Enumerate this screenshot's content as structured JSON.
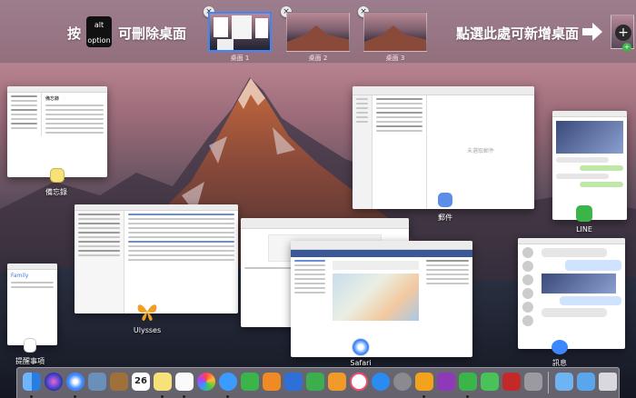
{
  "spaces_bar": {
    "hint_press": "按",
    "key_line1": "alt",
    "key_line2": "option",
    "hint_remove": "可刪除桌面",
    "hint_add": "點選此處可新增桌面",
    "close_glyph": "×",
    "add_glyph": "+",
    "desktops": [
      {
        "label": "桌面 1",
        "active": true
      },
      {
        "label": "桌面 2",
        "active": false
      },
      {
        "label": "桌面 3",
        "active": false
      }
    ]
  },
  "windows": {
    "notes": {
      "label": "備忘錄",
      "heading": "備忘錄"
    },
    "mail": {
      "label": "郵件",
      "placeholder": "未選取郵件"
    },
    "line": {
      "label": "LINE"
    },
    "ulysses": {
      "label": "Ulysses"
    },
    "reminders": {
      "label": "提醒事項",
      "list_title": "Family"
    },
    "safari": {
      "label": "Safari"
    },
    "messages": {
      "label": "訊息"
    }
  },
  "dock": {
    "calendar_day": "26",
    "apps": [
      "finder",
      "siri",
      "safari",
      "preview",
      "notebook",
      "calendar",
      "notes",
      "reminders",
      "photos",
      "messages",
      "facetime",
      "ibooks",
      "keynote",
      "numbers",
      "pages",
      "music",
      "appstore",
      "systemprefs",
      "ulysses",
      "onenote",
      "line",
      "evernote",
      "photobooth",
      "keychain",
      "folder",
      "downloads",
      "trash"
    ]
  },
  "colors": {
    "accent": "#3b87ff",
    "line_green": "#3bb54a"
  }
}
